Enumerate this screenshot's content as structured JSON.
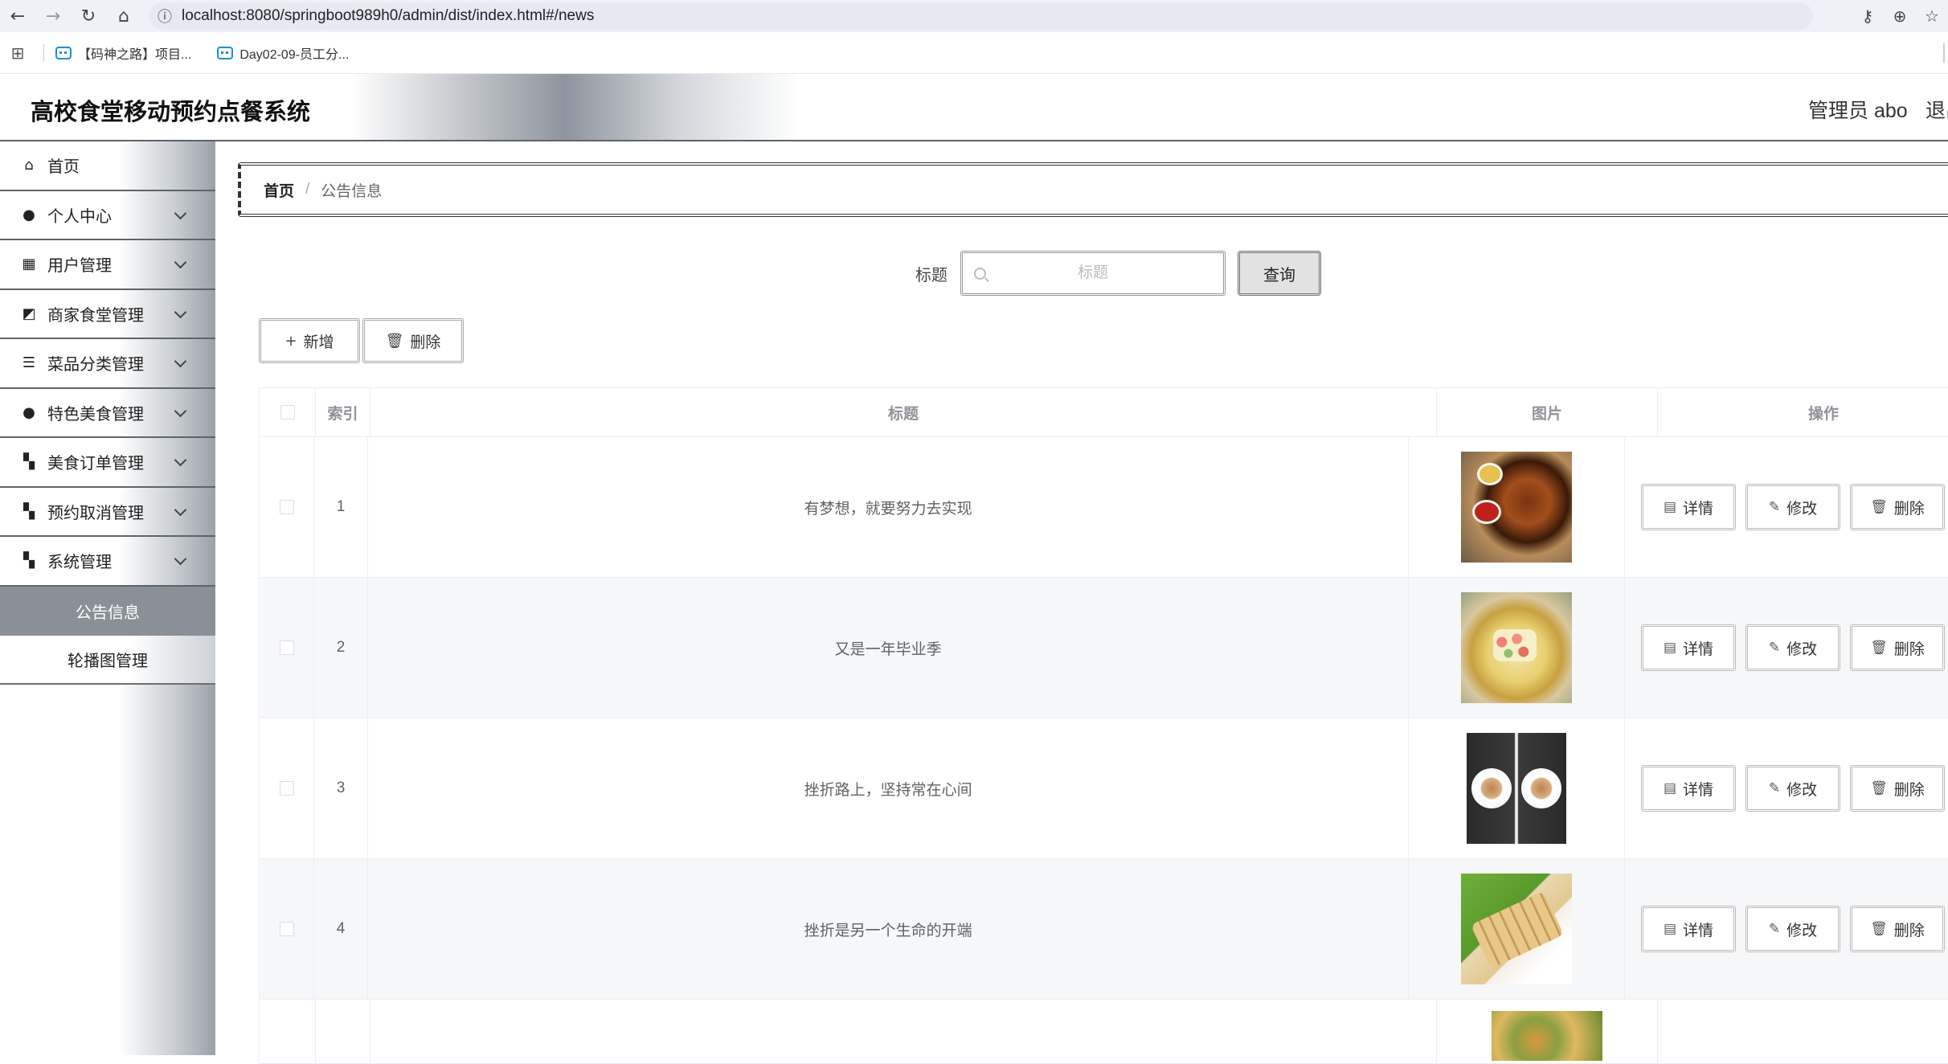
{
  "browser": {
    "url": "localhost:8080/springboot989h0/admin/dist/index.html#/news",
    "bookmarks": [
      {
        "label": "【码神之路】项目..."
      },
      {
        "label": "Day02-09-员工分..."
      }
    ]
  },
  "header": {
    "title": "高校食堂移动预约点餐系统",
    "user": "管理员 abo",
    "logout": "退出"
  },
  "sidebar": {
    "items": [
      {
        "label": "首页",
        "icon": "home-icon"
      },
      {
        "label": "个人中心",
        "icon": "user-icon"
      },
      {
        "label": "用户管理",
        "icon": "grid-icon"
      },
      {
        "label": "商家食堂管理",
        "icon": "chart-icon"
      },
      {
        "label": "菜品分类管理",
        "icon": "list-icon"
      },
      {
        "label": "特色美食管理",
        "icon": "bulb-icon"
      },
      {
        "label": "美食订单管理",
        "icon": "apps-icon"
      },
      {
        "label": "预约取消管理",
        "icon": "apps-icon"
      },
      {
        "label": "系统管理",
        "icon": "apps-icon"
      }
    ],
    "submenu": [
      {
        "label": "公告信息",
        "active": true
      },
      {
        "label": "轮播图管理",
        "active": false
      }
    ]
  },
  "breadcrumb": {
    "home": "首页",
    "separator": "/",
    "current": "公告信息"
  },
  "search": {
    "label": "标题",
    "placeholder": "标题",
    "value": "",
    "button": "查询"
  },
  "toolbar": {
    "add": "新增",
    "delete": "删除"
  },
  "table": {
    "columns": [
      "索引",
      "标题",
      "图片",
      "操作"
    ],
    "rows": [
      {
        "index": "1",
        "title": "有梦想，就要努力去实现"
      },
      {
        "index": "2",
        "title": "又是一年毕业季"
      },
      {
        "index": "3",
        "title": "挫折路上，坚持常在心间"
      },
      {
        "index": "4",
        "title": "挫折是另一个生命的开端"
      },
      {
        "index": "",
        "title": ""
      }
    ],
    "actions": {
      "detail": "详情",
      "edit": "修改",
      "delete": "删除"
    }
  },
  "colors": {
    "active_menu": "#8a9097",
    "border_dark": "#5d6268",
    "button_bg": "#e2e2e2"
  }
}
